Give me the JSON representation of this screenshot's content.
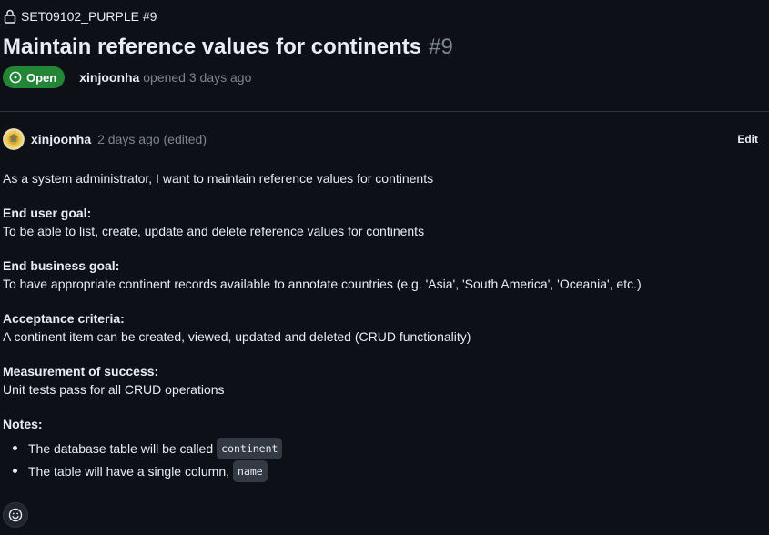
{
  "repo": {
    "label": "SET09102_PURPLE #9",
    "lock_icon": "lock-icon"
  },
  "issue": {
    "title": "Maintain reference values for continents",
    "number": "#9",
    "state": "Open",
    "author": "xinjoonha",
    "opened_text": "opened 3 days ago"
  },
  "comment": {
    "author": "xinjoonha",
    "time": "2 days ago (edited)",
    "edit_label": "Edit",
    "intro": "As a system administrator, I want to maintain reference values for continents",
    "sections": [
      {
        "heading": "End user goal:",
        "text": "To be able to list, create, update and delete reference values for continents"
      },
      {
        "heading": "End business goal:",
        "text": "To have appropriate continent records available to annotate countries (e.g. 'Asia', 'South America', 'Oceania', etc.)"
      },
      {
        "heading": "Acceptance criteria:",
        "text": "A continent item can be created, viewed, updated and deleted (CRUD functionality)"
      },
      {
        "heading": "Measurement of success:",
        "text": "Unit tests pass for all CRUD operations"
      }
    ],
    "notes_heading": "Notes:",
    "notes": [
      {
        "text": "The database table will be called",
        "code": "continent"
      },
      {
        "text": "The table will have a single column,",
        "code": "name"
      }
    ]
  },
  "colors": {
    "background": "#0d1117",
    "open_badge": "#238636",
    "muted_text": "#7d8590"
  }
}
